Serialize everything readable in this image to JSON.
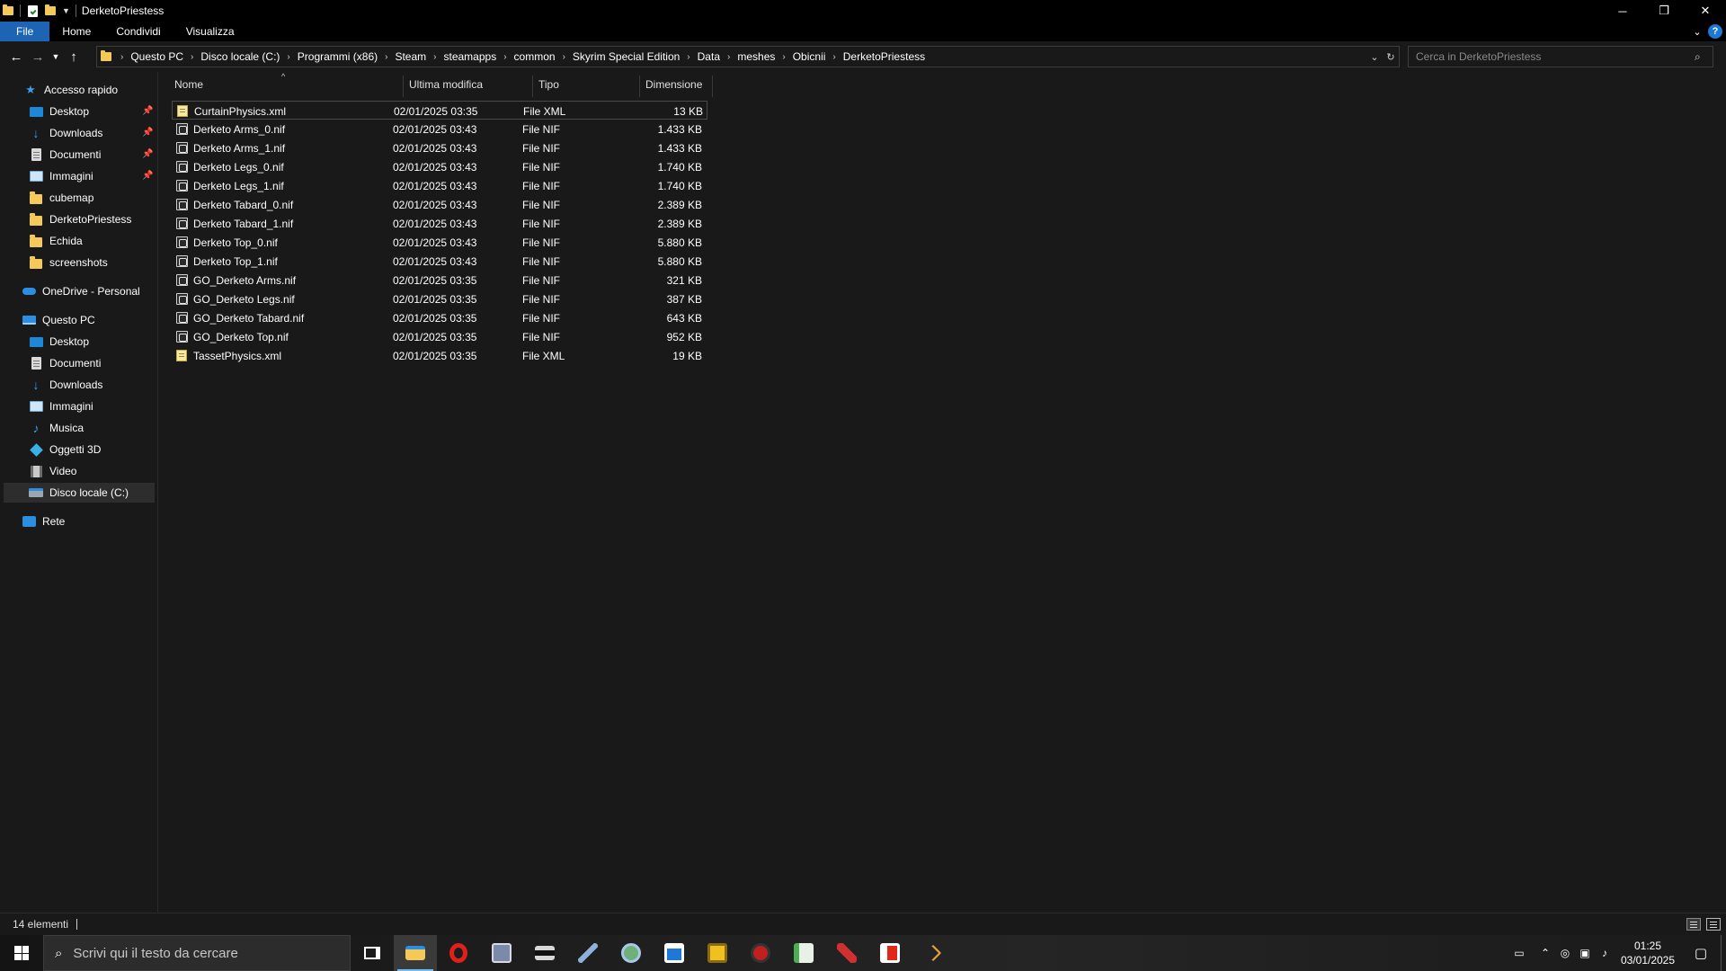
{
  "window": {
    "title": "DerketoPriestess",
    "controls": {
      "minimize": "─",
      "restore": "❐",
      "close": "✕"
    }
  },
  "ribbon": {
    "tabs": [
      "File",
      "Home",
      "Condividi",
      "Visualizza"
    ],
    "help": "?"
  },
  "address": {
    "crumbs": [
      "Questo PC",
      "Disco locale (C:)",
      "Programmi (x86)",
      "Steam",
      "steamapps",
      "common",
      "Skyrim Special Edition",
      "Data",
      "meshes",
      "Obicnii",
      "DerketoPriestess"
    ]
  },
  "search": {
    "placeholder": "Cerca in DerketoPriestess"
  },
  "sidebar": {
    "quick_access": "Accesso rapido",
    "quick_items": [
      {
        "label": "Desktop",
        "icon": "desktop-icon",
        "pinned": true
      },
      {
        "label": "Downloads",
        "icon": "download-icon",
        "pinned": true
      },
      {
        "label": "Documenti",
        "icon": "document-icon",
        "pinned": true
      },
      {
        "label": "Immagini",
        "icon": "pictures-icon",
        "pinned": true
      },
      {
        "label": "cubemap",
        "icon": "folder-icon",
        "pinned": false
      },
      {
        "label": "DerketoPriestess",
        "icon": "folder-icon",
        "pinned": false
      },
      {
        "label": "Echida",
        "icon": "folder-icon",
        "pinned": false
      },
      {
        "label": "screenshots",
        "icon": "folder-icon",
        "pinned": false
      }
    ],
    "onedrive": "OneDrive - Personal",
    "this_pc": "Questo PC",
    "pc_items": [
      {
        "label": "Desktop",
        "icon": "desktop-icon"
      },
      {
        "label": "Documenti",
        "icon": "document-icon"
      },
      {
        "label": "Downloads",
        "icon": "download-icon"
      },
      {
        "label": "Immagini",
        "icon": "pictures-icon"
      },
      {
        "label": "Musica",
        "icon": "music-icon"
      },
      {
        "label": "Oggetti 3D",
        "icon": "3d-objects-icon"
      },
      {
        "label": "Video",
        "icon": "video-icon"
      },
      {
        "label": "Disco locale (C:)",
        "icon": "drive-icon"
      }
    ],
    "network": "Rete"
  },
  "columns": {
    "name": "Nome",
    "modified": "Ultima modifica",
    "type": "Tipo",
    "size": "Dimensione"
  },
  "files": [
    {
      "name": "CurtainPhysics.xml",
      "modified": "02/01/2025 03:35",
      "type": "File XML",
      "size": "13 KB",
      "kind": "xml"
    },
    {
      "name": "Derketo Arms_0.nif",
      "modified": "02/01/2025 03:43",
      "type": "File NIF",
      "size": "1.433 KB",
      "kind": "nif"
    },
    {
      "name": "Derketo Arms_1.nif",
      "modified": "02/01/2025 03:43",
      "type": "File NIF",
      "size": "1.433 KB",
      "kind": "nif"
    },
    {
      "name": "Derketo Legs_0.nif",
      "modified": "02/01/2025 03:43",
      "type": "File NIF",
      "size": "1.740 KB",
      "kind": "nif"
    },
    {
      "name": "Derketo Legs_1.nif",
      "modified": "02/01/2025 03:43",
      "type": "File NIF",
      "size": "1.740 KB",
      "kind": "nif"
    },
    {
      "name": "Derketo Tabard_0.nif",
      "modified": "02/01/2025 03:43",
      "type": "File NIF",
      "size": "2.389 KB",
      "kind": "nif"
    },
    {
      "name": "Derketo Tabard_1.nif",
      "modified": "02/01/2025 03:43",
      "type": "File NIF",
      "size": "2.389 KB",
      "kind": "nif"
    },
    {
      "name": "Derketo Top_0.nif",
      "modified": "02/01/2025 03:43",
      "type": "File NIF",
      "size": "5.880 KB",
      "kind": "nif"
    },
    {
      "name": "Derketo Top_1.nif",
      "modified": "02/01/2025 03:43",
      "type": "File NIF",
      "size": "5.880 KB",
      "kind": "nif"
    },
    {
      "name": "GO_Derketo Arms.nif",
      "modified": "02/01/2025 03:35",
      "type": "File NIF",
      "size": "321 KB",
      "kind": "nif"
    },
    {
      "name": "GO_Derketo Legs.nif",
      "modified": "02/01/2025 03:35",
      "type": "File NIF",
      "size": "387 KB",
      "kind": "nif"
    },
    {
      "name": "GO_Derketo Tabard.nif",
      "modified": "02/01/2025 03:35",
      "type": "File NIF",
      "size": "643 KB",
      "kind": "nif"
    },
    {
      "name": "GO_Derketo Top.nif",
      "modified": "02/01/2025 03:35",
      "type": "File NIF",
      "size": "952 KB",
      "kind": "nif"
    },
    {
      "name": "TassetPhysics.xml",
      "modified": "02/01/2025 03:35",
      "type": "File XML",
      "size": "19 KB",
      "kind": "xml"
    }
  ],
  "status": {
    "count": "14 elementi"
  },
  "taskbar": {
    "search_placeholder": "Scrivi qui il testo da cercare",
    "apps": [
      {
        "name": "task-view-icon",
        "color": "#2c2c2c"
      },
      {
        "name": "file-explorer-icon",
        "color": "#f4c95a",
        "active": true
      },
      {
        "name": "opera-icon",
        "color": "#e0201a"
      },
      {
        "name": "app-icon-3",
        "color": "#7a8aa8"
      },
      {
        "name": "app-icon-4",
        "color": "#d8d8d8"
      },
      {
        "name": "app-icon-5",
        "color": "#8fb0d8"
      },
      {
        "name": "app-icon-6",
        "color": "#6fb07a"
      },
      {
        "name": "app-icon-7",
        "color": "#1e78d6"
      },
      {
        "name": "app-icon-8",
        "color": "#f0c020"
      },
      {
        "name": "app-icon-9",
        "color": "#c02020"
      },
      {
        "name": "app-icon-10",
        "color": "#4caf50"
      },
      {
        "name": "app-icon-11",
        "color": "#d03030"
      },
      {
        "name": "app-icon-12",
        "color": "#e02818"
      },
      {
        "name": "app-icon-13",
        "color": "#e0a040"
      }
    ],
    "time": "01:25",
    "date": "03/01/2025"
  },
  "colors": {
    "accent": "#1e64b4",
    "folder": "#f4c95a",
    "background": "#191919"
  }
}
